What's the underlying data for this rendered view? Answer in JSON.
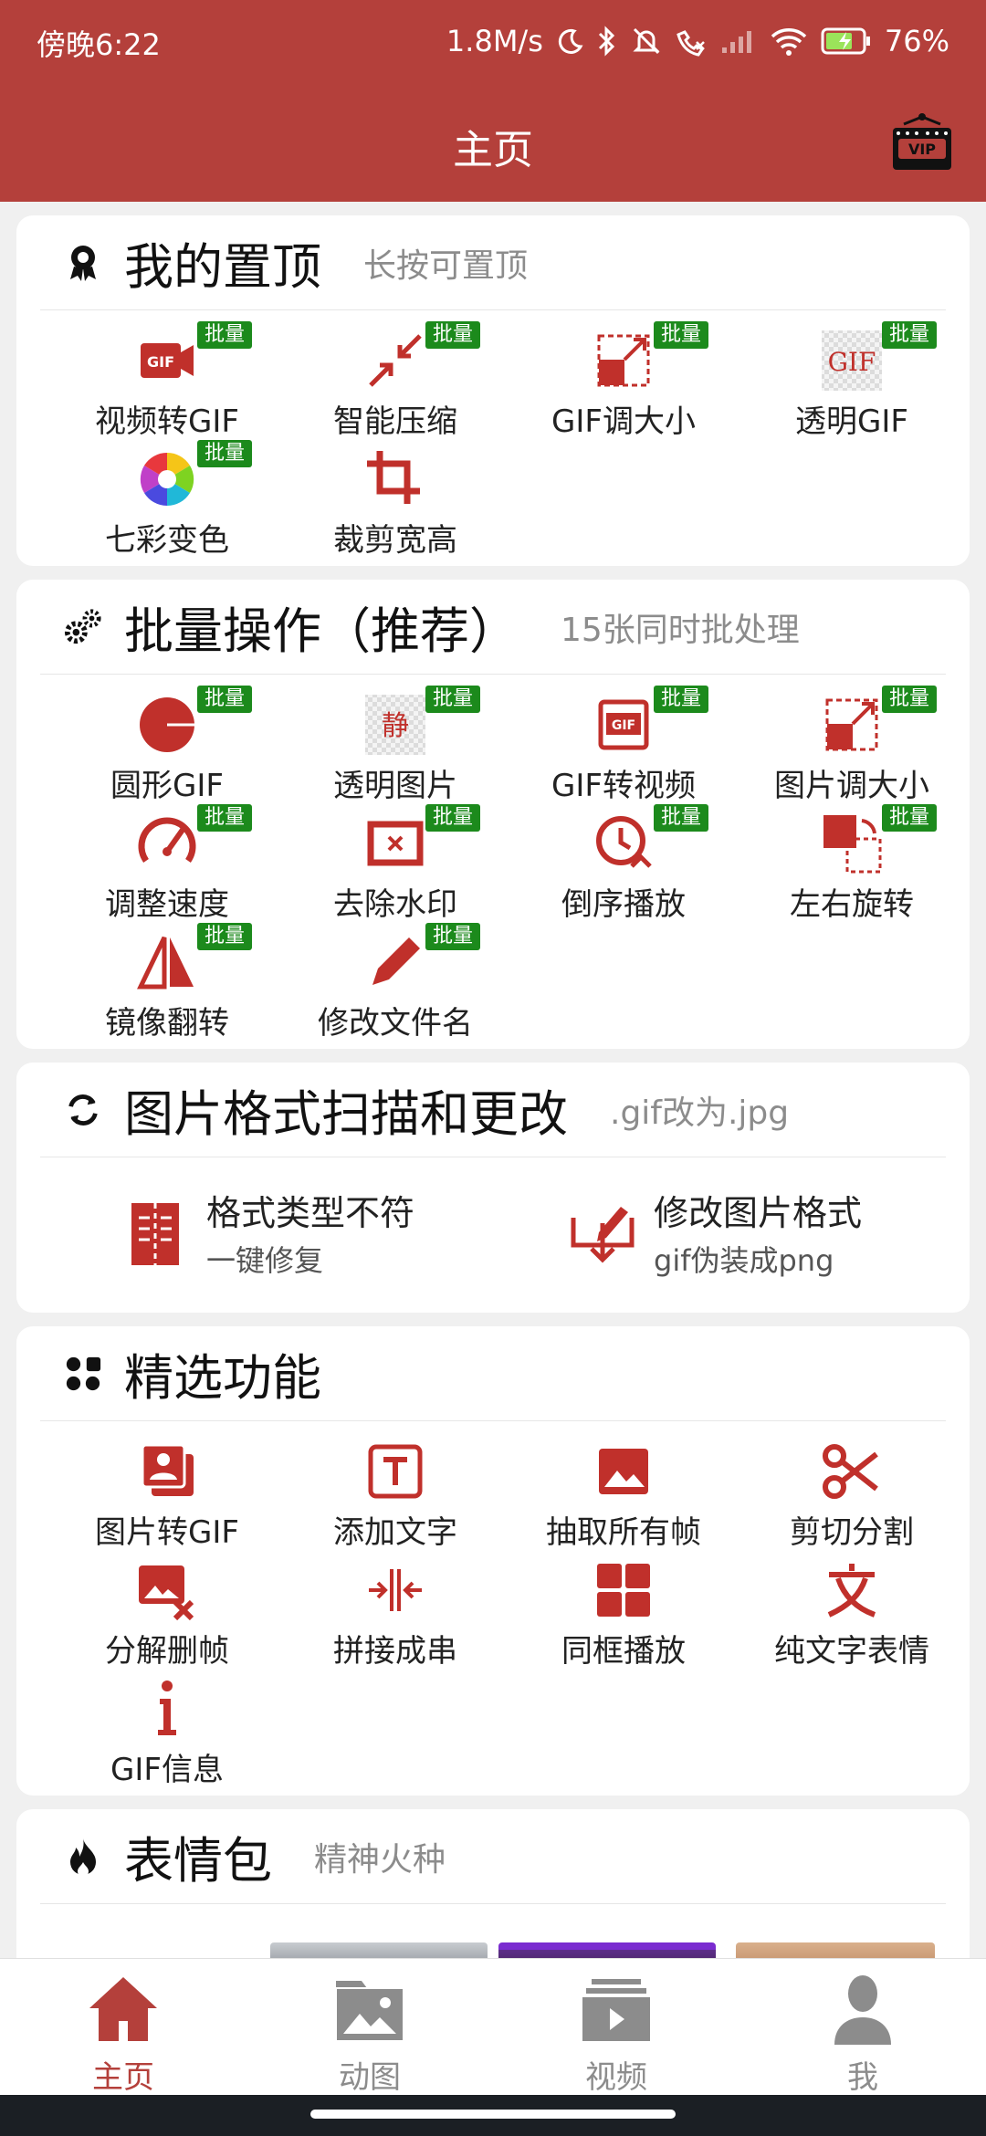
{
  "status": {
    "time": "傍晚6:22",
    "speed": "1.8M/s",
    "battery": "76%"
  },
  "header": {
    "title": "主页",
    "vip_icon": "vip-icon"
  },
  "badge_text": "批量",
  "pinned": {
    "title": "我的置顶",
    "subtitle": "长按可置顶",
    "items": [
      {
        "label": "视频转GIF",
        "icon": "video-to-gif-icon"
      },
      {
        "label": "智能压缩",
        "icon": "compress-icon"
      },
      {
        "label": "GIF调大小",
        "icon": "resize-icon"
      },
      {
        "label": "透明GIF",
        "icon": "transparent-gif-icon"
      },
      {
        "label": "七彩变色",
        "icon": "color-wheel-icon"
      },
      {
        "label": "裁剪宽高",
        "icon": "crop-icon"
      }
    ]
  },
  "batch": {
    "title": "批量操作（推荐）",
    "subtitle": "15张同时批处理",
    "items": [
      {
        "label": "圆形GIF",
        "icon": "circle-gif-icon"
      },
      {
        "label": "透明图片",
        "icon": "transparent-image-icon"
      },
      {
        "label": "GIF转视频",
        "icon": "gif-to-video-icon"
      },
      {
        "label": "图片调大小",
        "icon": "image-resize-icon"
      },
      {
        "label": "调整速度",
        "icon": "speed-icon"
      },
      {
        "label": "去除水印",
        "icon": "remove-watermark-icon"
      },
      {
        "label": "倒序播放",
        "icon": "reverse-icon"
      },
      {
        "label": "左右旋转",
        "icon": "rotate-icon"
      },
      {
        "label": "镜像翻转",
        "icon": "mirror-icon"
      },
      {
        "label": "修改文件名",
        "icon": "rename-icon"
      }
    ]
  },
  "scan": {
    "title": "图片格式扫描和更改",
    "subtitle": ".gif改为.jpg",
    "items": [
      {
        "title": "格式类型不符",
        "sub": "一键修复",
        "icon": "archive-icon"
      },
      {
        "title": "修改图片格式",
        "sub": "gif伪装成png",
        "icon": "edit-download-icon"
      }
    ]
  },
  "featured": {
    "title": "精选功能",
    "items": [
      {
        "label": "图片转GIF",
        "icon": "photos-icon"
      },
      {
        "label": "添加文字",
        "icon": "text-box-icon"
      },
      {
        "label": "抽取所有帧",
        "icon": "image-icon"
      },
      {
        "label": "剪切分割",
        "icon": "scissors-icon"
      },
      {
        "label": "分解删帧",
        "icon": "image-delete-icon"
      },
      {
        "label": "拼接成串",
        "icon": "join-icon"
      },
      {
        "label": "同框播放",
        "icon": "grid-icon"
      },
      {
        "label": "纯文字表情",
        "icon": "text-char-icon"
      },
      {
        "label": "GIF信息",
        "icon": "info-icon"
      }
    ]
  },
  "memes": {
    "title": "表情包",
    "subtitle": "精神火种"
  },
  "nav": [
    {
      "label": "主页",
      "icon": "home-icon",
      "active": true
    },
    {
      "label": "动图",
      "icon": "folder-image-icon",
      "active": false
    },
    {
      "label": "视频",
      "icon": "video-icon",
      "active": false
    },
    {
      "label": "我",
      "icon": "person-icon",
      "active": false
    }
  ],
  "colors": {
    "brand": "#b4403b",
    "icon_red": "#c0302b",
    "badge": "#1c8a1c",
    "nav_inactive": "#8c8c8c"
  }
}
